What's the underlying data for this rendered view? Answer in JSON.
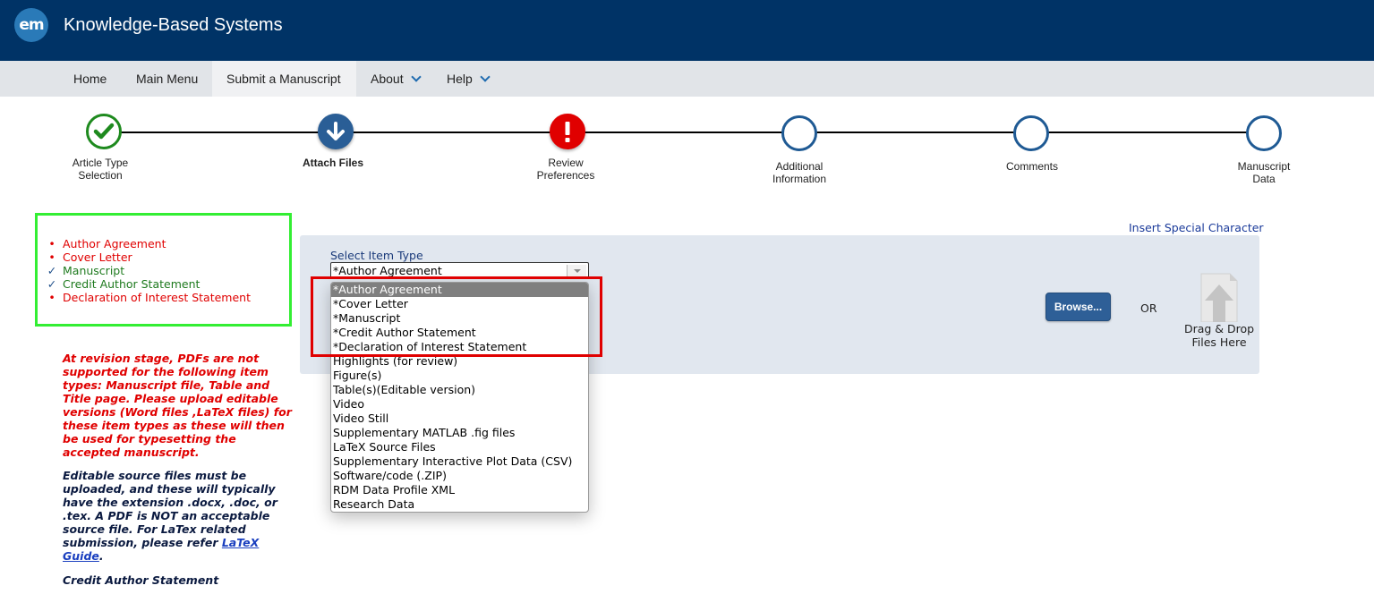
{
  "header": {
    "logo_text": "em",
    "title": "Knowledge-Based Systems"
  },
  "nav": {
    "items": [
      {
        "label": "Home"
      },
      {
        "label": "Main Menu"
      },
      {
        "label": "Submit a Manuscript",
        "active": true
      },
      {
        "label": "About",
        "has_dropdown": true
      },
      {
        "label": "Help",
        "has_dropdown": true
      }
    ]
  },
  "stepper": {
    "steps": [
      {
        "label_line1": "Article Type",
        "label_line2": "Selection",
        "status": "complete",
        "icon": "check-icon"
      },
      {
        "label_line1": "Attach Files",
        "label_line2": "",
        "status": "current",
        "icon": "arrow-down-icon"
      },
      {
        "label_line1": "Review",
        "label_line2": "Preferences",
        "status": "error",
        "icon": "exclamation-icon"
      },
      {
        "label_line1": "Additional",
        "label_line2": "Information",
        "status": "pending"
      },
      {
        "label_line1": "Comments",
        "label_line2": "",
        "status": "pending"
      },
      {
        "label_line1": "Manuscript",
        "label_line2": "Data",
        "status": "pending"
      }
    ]
  },
  "checklist": {
    "items": [
      {
        "label": "Author Agreement",
        "status": "missing",
        "marker": "•"
      },
      {
        "label": "Cover Letter",
        "status": "missing",
        "marker": "•"
      },
      {
        "label": "Manuscript",
        "status": "done",
        "marker": "✓"
      },
      {
        "label": "Credit Author Statement",
        "status": "done",
        "marker": "✓"
      },
      {
        "label": "Declaration of Interest Statement",
        "status": "missing",
        "marker": "•"
      }
    ]
  },
  "notes": {
    "revision_note": "At revision stage, PDFs are not supported for the following item types: Manuscript file, Table and Title page. Please upload editable versions (Word files ,LaTeX files) for these item types as these will then be used for typesetting the accepted manuscript.",
    "source_note_prefix": "Editable source files must be uploaded, and these will typically have the extension .docx, .doc, or .tex. A PDF is NOT an acceptable source file. For LaTex related submission, please refer ",
    "source_note_link": "LaTeX Guide",
    "source_note_suffix": ".",
    "credit_heading": "Credit Author Statement"
  },
  "upload": {
    "special_char_link": "Insert Special Character",
    "select_label": "Select Item Type",
    "selected_value": "*Author Agreement",
    "options": [
      "*Author Agreement",
      "*Cover Letter",
      "*Manuscript",
      "*Credit Author Statement",
      "*Declaration of Interest Statement",
      "Highlights (for review)",
      "Figure(s)",
      "Table(s)(Editable version)",
      "Video",
      "Video Still",
      "Supplementary MATLAB .fig files",
      "LaTeX Source Files",
      "Supplementary Interactive Plot Data (CSV)",
      "Software/code (.ZIP)",
      "RDM Data Profile XML",
      "Research Data"
    ],
    "browse_label": "Browse...",
    "or_label": "OR",
    "drop_line1": "Drag & Drop",
    "drop_line2": "Files Here"
  },
  "colors": {
    "header_bg": "#003366",
    "nav_bg": "#e1e4e8",
    "complete": "#1e8a1e",
    "current": "#2a5e96",
    "error": "#e00000",
    "pending_ring": "#1f5a94",
    "checklist_border": "#33ee33",
    "highlight_frame": "#e00000",
    "upload_panel": "#e1e7ef",
    "browse_button": "#2e5f97"
  }
}
